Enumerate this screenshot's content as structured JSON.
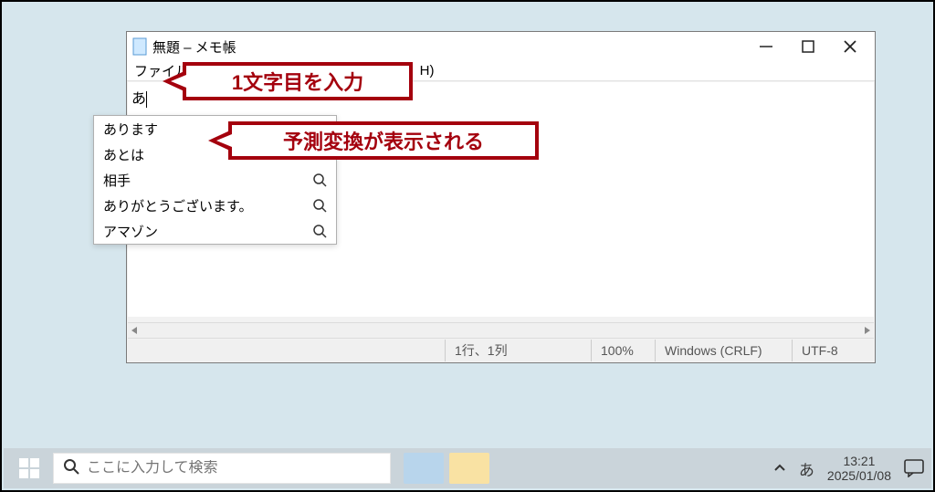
{
  "notepad": {
    "title": "無題  – メモ帳",
    "menu": {
      "file": "ファイル(F)",
      "help_tail": "H)"
    },
    "typed": "あ",
    "status": {
      "pos": "1行、1列",
      "zoom": "100%",
      "eol": "Windows (CRLF)",
      "enc": "UTF-8"
    }
  },
  "ime": {
    "items": [
      {
        "label": "あります",
        "search": false
      },
      {
        "label": "あとは",
        "search": false
      },
      {
        "label": "相手",
        "search": true
      },
      {
        "label": "ありがとうございます。",
        "search": true
      },
      {
        "label": "アマゾン",
        "search": true
      }
    ]
  },
  "callout": {
    "c1": "1文字目を入力",
    "c2": "予測変換が表示される"
  },
  "taskbar": {
    "search_placeholder": "ここに入力して検索",
    "ime_indicator": "あ",
    "clock": {
      "time": "13:21",
      "date": "2025/01/08"
    }
  }
}
